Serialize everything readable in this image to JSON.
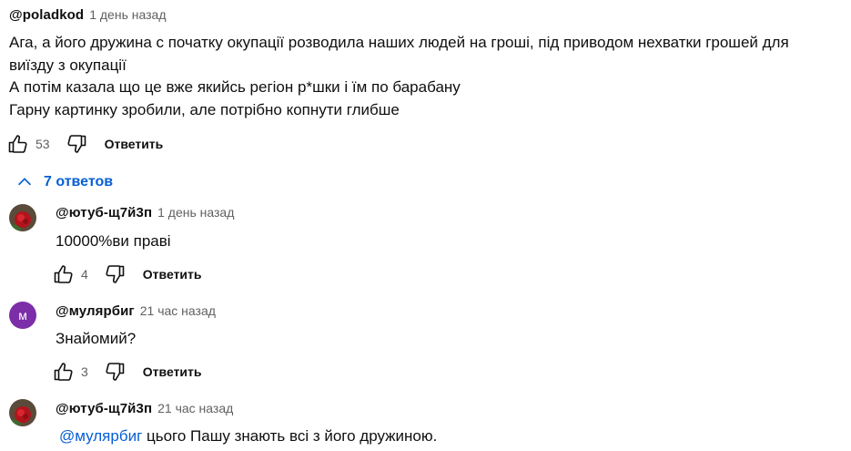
{
  "main_comment": {
    "author": "@poladkod",
    "time": "1 день назад",
    "lines": [
      "Ага, а його дружина с початку окупації розводила наших людей на гроші, під приводом нехватки грошей для",
      "виїзду з окупації",
      "А потім казала що це вже якийсь регіон р*шки і їм по барабану",
      "Гарну картинку зробили, але потрібно копнути глибше"
    ],
    "likes": "53",
    "reply_label": "Ответить"
  },
  "replies_toggle": {
    "label": "7 ответов"
  },
  "replies": [
    {
      "author": "@ютуб-щ7й3п",
      "time": "1 день назад",
      "mention": "",
      "text": "10000%ви праві",
      "likes": "4",
      "reply_label": "Ответить"
    },
    {
      "author": "@мулярбиг",
      "time": "21 час назад",
      "avatar_letter": "м",
      "mention": "",
      "text": "Знайомий?",
      "likes": "3",
      "reply_label": "Ответить"
    },
    {
      "author": "@ютуб-щ7й3п",
      "time": "21 час назад",
      "mention": "@мулярбиг",
      "text": " цього Пашу знають всі з його дружиною."
    }
  ],
  "colors": {
    "link": "#065fd4",
    "avatar_purple": "#7b2ea8",
    "muted": "#606060"
  },
  "icons": [
    "thumb-up-icon",
    "thumb-down-icon",
    "chevron-up-icon",
    "avatar-rose-image"
  ]
}
